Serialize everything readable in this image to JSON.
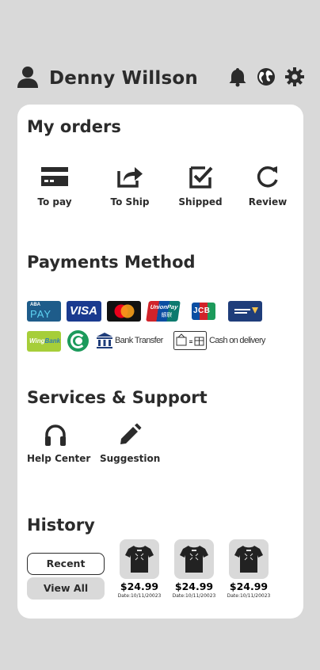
{
  "header": {
    "user_name": "Denny Willson",
    "icons": [
      "user-icon",
      "bell-icon",
      "globe-icon",
      "gear-icon"
    ]
  },
  "orders": {
    "title": "My orders",
    "items": [
      {
        "label": "To pay",
        "icon": "card-icon"
      },
      {
        "label": "To Ship",
        "icon": "share-icon"
      },
      {
        "label": "Shipped",
        "icon": "checkbox-icon"
      },
      {
        "label": "Review",
        "icon": "refresh-icon"
      }
    ]
  },
  "payments": {
    "title": "Payments Method",
    "methods": [
      {
        "name": "ABA PAY",
        "line1": "ABA",
        "line2": "PAY",
        "color": "#1e5c8a"
      },
      {
        "name": "VISA",
        "color": "#1a3a8f"
      },
      {
        "name": "Mastercard",
        "color": "#111111"
      },
      {
        "name": "UnionPay",
        "line1": "UnionPay",
        "line2": "银联",
        "color": "#d1232a"
      },
      {
        "name": "JCB",
        "color": "#0b4ea2"
      },
      {
        "name": "Acleda",
        "color": "#1f3d7a"
      },
      {
        "name": "Wing Bank",
        "color": "#a6ce39"
      },
      {
        "name": "Chip Mong",
        "color": "#1c9a5b"
      },
      {
        "name": "Bank Transfer",
        "label": "Bank Transfer",
        "color": "#1f3d7a"
      },
      {
        "name": "Cash on delivery",
        "label": "Cash on delivery",
        "color": "#333333"
      }
    ]
  },
  "services": {
    "title": "Services & Support",
    "items": [
      {
        "label": "Help Center",
        "icon": "headphones-icon"
      },
      {
        "label": "Suggestion",
        "icon": "pencil-icon"
      }
    ]
  },
  "history": {
    "title": "History",
    "recent_label": "Recent",
    "view_all_label": "View All",
    "items": [
      {
        "price": "$24.99",
        "date": "Date:10/11/20023"
      },
      {
        "price": "$24.99",
        "date": "Date:10/11/20023"
      },
      {
        "price": "$24.99",
        "date": "Date:10/11/20023"
      }
    ]
  },
  "colors": {
    "background": "#d9d9d9",
    "card": "#ffffff",
    "text": "#2b2b2b"
  }
}
